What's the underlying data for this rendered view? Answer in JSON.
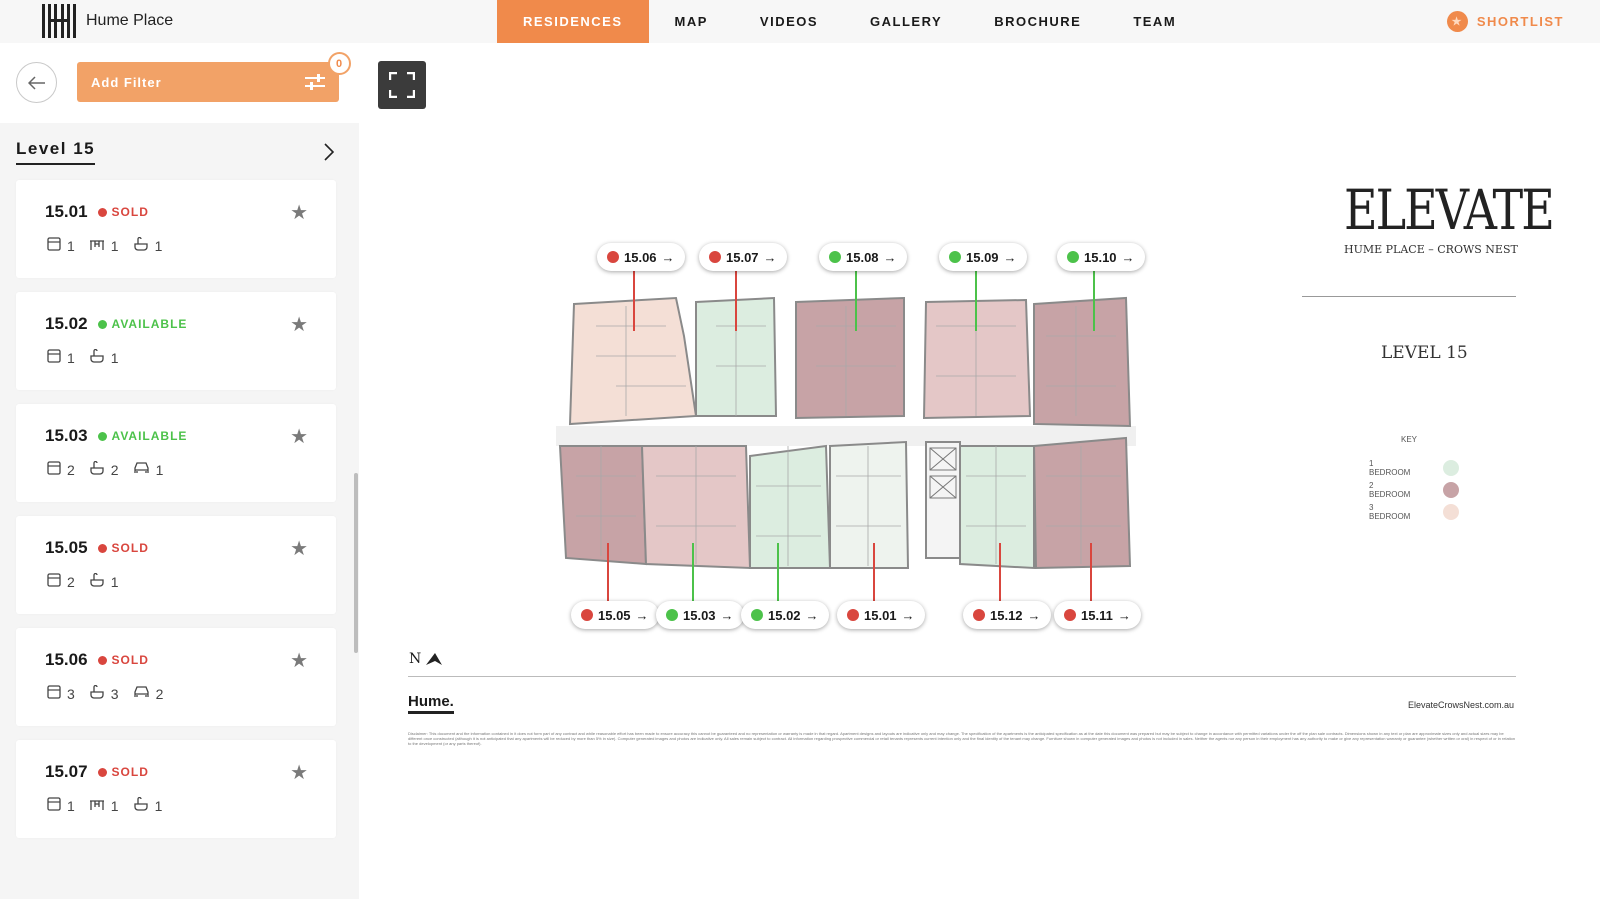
{
  "header": {
    "brand_name": "Hume Place",
    "nav": [
      {
        "label": "RESIDENCES",
        "active": true
      },
      {
        "label": "MAP",
        "active": false
      },
      {
        "label": "VIDEOS",
        "active": false
      },
      {
        "label": "GALLERY",
        "active": false
      },
      {
        "label": "BROCHURE",
        "active": false
      },
      {
        "label": "TEAM",
        "active": false
      }
    ],
    "shortlist_label": "SHORTLIST",
    "accent_color": "#f08a4b"
  },
  "sidebar": {
    "filter_label": "Add Filter",
    "filter_count": "0",
    "level_title": "Level 15",
    "units": [
      {
        "number": "15.01",
        "status": "SOLD",
        "bed": "1",
        "study": "1",
        "bath": "1",
        "car": ""
      },
      {
        "number": "15.02",
        "status": "AVAILABLE",
        "bed": "1",
        "study": "",
        "bath": "1",
        "car": ""
      },
      {
        "number": "15.03",
        "status": "AVAILABLE",
        "bed": "2",
        "study": "",
        "bath": "2",
        "car": "1"
      },
      {
        "number": "15.05",
        "status": "SOLD",
        "bed": "2",
        "study": "",
        "bath": "1",
        "car": ""
      },
      {
        "number": "15.06",
        "status": "SOLD",
        "bed": "3",
        "study": "",
        "bath": "3",
        "car": "2"
      },
      {
        "number": "15.07",
        "status": "SOLD",
        "bed": "1",
        "study": "1",
        "bath": "1",
        "car": ""
      }
    ],
    "status_colors": {
      "SOLD": "#d9463e",
      "AVAILABLE": "#4cc24a"
    }
  },
  "floorplan": {
    "pins_top": [
      {
        "label": "15.06",
        "status": "SOLD"
      },
      {
        "label": "15.07",
        "status": "SOLD"
      },
      {
        "label": "15.08",
        "status": "AVAILABLE"
      },
      {
        "label": "15.09",
        "status": "AVAILABLE"
      },
      {
        "label": "15.10",
        "status": "AVAILABLE"
      }
    ],
    "pins_bottom": [
      {
        "label": "15.05",
        "status": "SOLD"
      },
      {
        "label": "15.03",
        "status": "AVAILABLE"
      },
      {
        "label": "15.02",
        "status": "AVAILABLE"
      },
      {
        "label": "15.01",
        "status": "SOLD"
      },
      {
        "label": "15.12",
        "status": "SOLD"
      },
      {
        "label": "15.11",
        "status": "SOLD"
      }
    ],
    "arrow_glyph": "→"
  },
  "panel": {
    "title": "ELEVATE",
    "subtitle": "HUME PLACE – CROWS NEST",
    "level_label": "LEVEL 15",
    "key_title": "KEY",
    "key": [
      {
        "label": "1 BEDROOM",
        "color": "#dcede0"
      },
      {
        "label": "2 BEDROOM",
        "color": "#c7a3a6"
      },
      {
        "label": "3 BEDROOM",
        "color": "#f4dfd6"
      }
    ],
    "north_label": "N",
    "footer_logo": "Hume.",
    "site_url": "ElevateCrowsNest.com.au",
    "disclaimer": "Disclaimer: This document and the information contained in it does not form part of any contract and while reasonable effort has been made to ensure accuracy this cannot be guaranteed and no representation or warranty is made in that regard. Apartment designs and layouts are indicative only and may change. The specification of the apartments is the anticipated specification as at the date this document was prepared but may be subject to change in accordance with permitted variations under the off the plan sale contracts. Dimensions shown in any text or plan are approximate sizes only and actual sizes may be different once constructed (although it is not anticipated that any apartments will be reduced by more than 5% in size). Computer generated images and photos are indicative only. All sales remain subject to contract. All information regarding prospective commercial or retail tenants represents current intention only and the final identity of the tenant may change. Furniture shown in computer generated images and photos is not included in sales. Neither the agents nor any person in their employment has any authority to make or give any representation warranty or guarantee (whether written or oral) in respect of or in relation to the development (or any parts thereof)."
  }
}
